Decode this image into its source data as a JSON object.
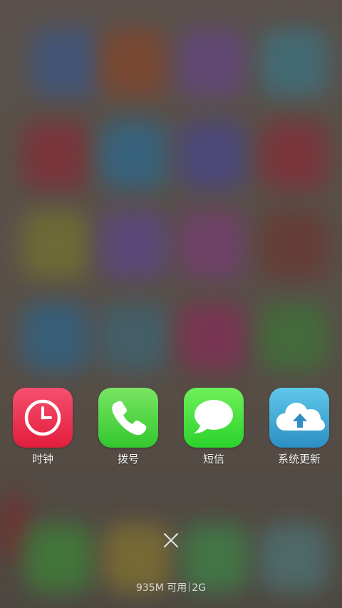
{
  "recent_apps": [
    {
      "label": "时钟",
      "icon": "clock-icon",
      "color": "#e8304f"
    },
    {
      "label": "拨号",
      "icon": "phone-icon",
      "color": "#4cd43e"
    },
    {
      "label": "短信",
      "icon": "message-bubble-icon",
      "color": "#3fdb37"
    },
    {
      "label": "系统更新",
      "icon": "cloud-upload-icon",
      "color": "#3fa8d6"
    }
  ],
  "close_all": {
    "icon": "close-icon"
  },
  "memory": {
    "available": "935M 可用",
    "total": "2G"
  }
}
